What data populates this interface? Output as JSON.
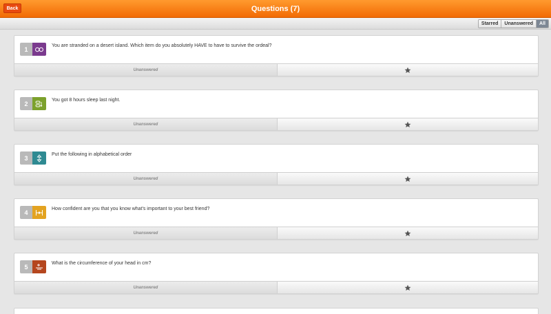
{
  "header": {
    "back_label": "Back",
    "title": "Questions (7)",
    "accent": "#f57c0a"
  },
  "filters": [
    {
      "label": "Starred",
      "active": false
    },
    {
      "label": "Unanswered",
      "active": false
    },
    {
      "label": "All",
      "active": true
    }
  ],
  "questions": [
    {
      "number": "1",
      "text": "You are stranded on a desert island. Which item do you absolutely HAVE to have to survive the ordeal?",
      "status": "Unanswered",
      "color": "#7b3a8e",
      "icon": "link-icon"
    },
    {
      "number": "2",
      "text": "You got 8 hours sleep last night.",
      "status": "Unanswered",
      "color": "#7ca12c",
      "icon": "toggle-icon"
    },
    {
      "number": "3",
      "text": "Put the following in alphabetical order",
      "status": "Unanswered",
      "color": "#2f8a92",
      "icon": "sort-icon"
    },
    {
      "number": "4",
      "text": "How confident are you that you know what's important to your best friend?",
      "status": "Unanswered",
      "color": "#e3a321",
      "icon": "scale-icon"
    },
    {
      "number": "5",
      "text": "What is the circumference of your head in cm?",
      "status": "Unanswered",
      "color": "#b5461e",
      "icon": "number-icon"
    }
  ]
}
